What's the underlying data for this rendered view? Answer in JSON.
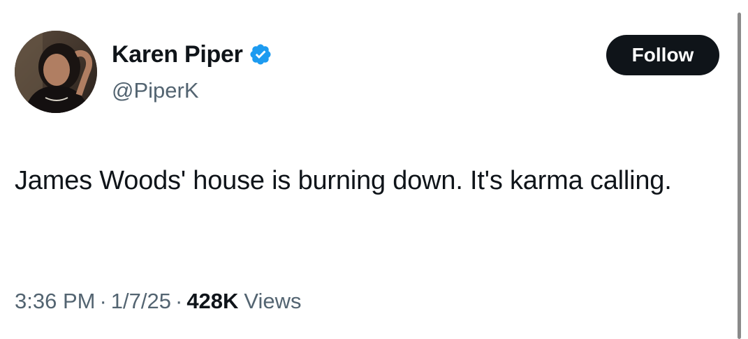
{
  "author": {
    "display_name": "Karen Piper",
    "handle": "@PiperK",
    "verified": true,
    "verified_badge_color": "#1d9bf0"
  },
  "follow_button": {
    "label": "Follow"
  },
  "tweet": {
    "text": "James Woods' house is burning down. It's karma calling."
  },
  "meta": {
    "time": "3:36 PM",
    "separator": "·",
    "date": "1/7/25",
    "views_count": "428K",
    "views_label": "Views"
  },
  "colors": {
    "text_primary": "#0f1419",
    "text_secondary": "#536471",
    "button_bg": "#0f1419",
    "button_text": "#ffffff"
  }
}
